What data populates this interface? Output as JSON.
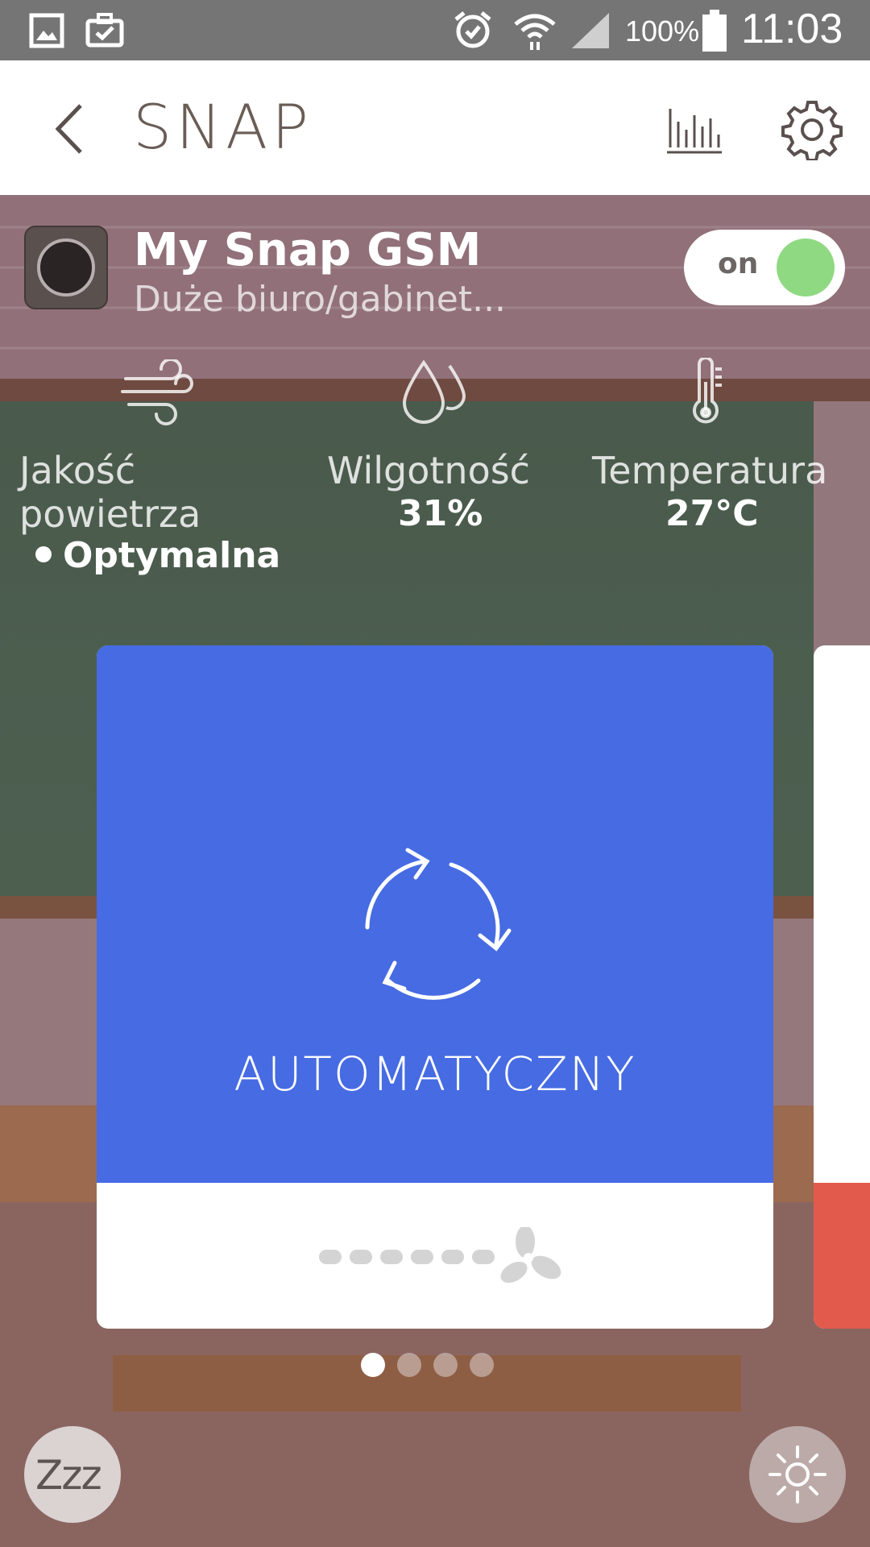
{
  "status_bar": {
    "battery_percent": "100%",
    "time": "11:03",
    "icons": [
      "gallery-icon",
      "briefcase-check-icon",
      "alarm-icon",
      "wifi-icon",
      "signal-icon",
      "battery-icon"
    ]
  },
  "app_bar": {
    "title": "SNAP",
    "icons": [
      "back-icon",
      "stats-icon",
      "gear-icon"
    ]
  },
  "device": {
    "name": "My Snap GSM",
    "room": "Duże biuro/gabinet...",
    "toggle_label": "on",
    "toggle_color": "#8fd982"
  },
  "metrics": {
    "air_quality": {
      "label_line1": "Jakość",
      "label_line2": "powietrza",
      "status": "Optymalna",
      "icon": "wind-icon"
    },
    "humidity": {
      "label": "Wilgotność",
      "value": "31%",
      "icon": "droplets-icon"
    },
    "temperature": {
      "label": "Temperatura",
      "value": "27°C",
      "icon": "thermometer-icon"
    }
  },
  "mode_card": {
    "label": "AUTOMATYCZNY",
    "accent_color": "#466be3",
    "icon": "auto-cycle-icon",
    "fan_icon": "fan-icon",
    "fan_speed_dots": 6
  },
  "next_card": {
    "accent_color": "#e25a4c"
  },
  "pager": {
    "total": 4,
    "active_index": 0
  },
  "fabs": {
    "sleep_label": "Zzz",
    "light_icon": "brightness-icon"
  }
}
